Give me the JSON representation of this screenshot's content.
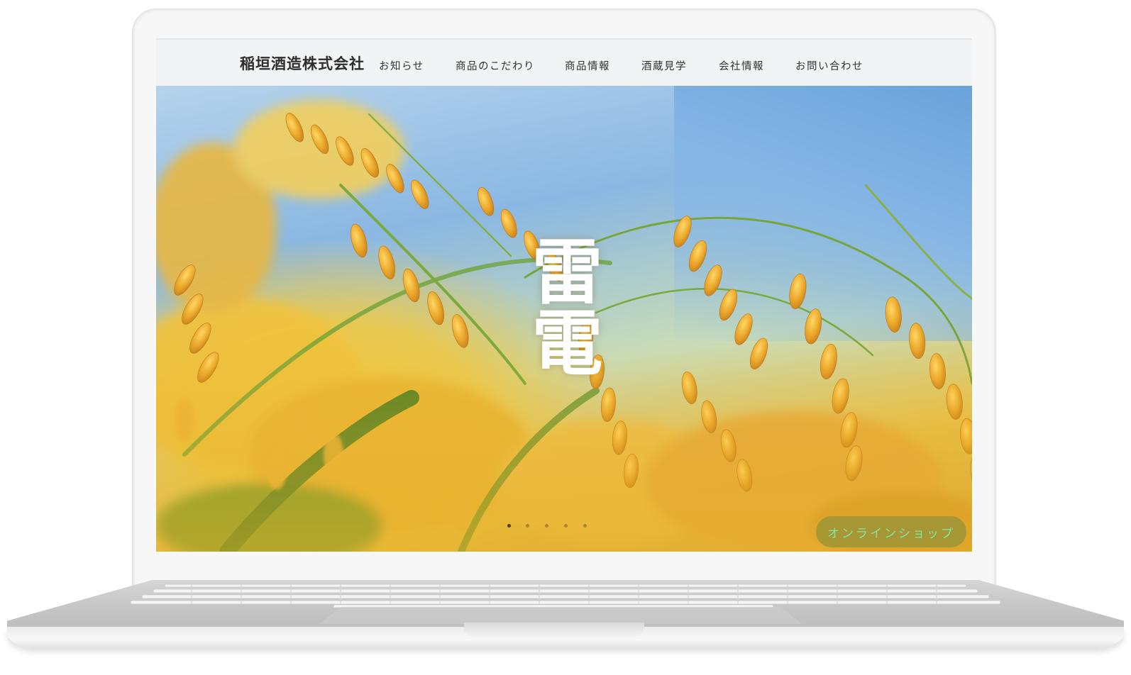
{
  "site": {
    "brand": "稲垣酒造株式会社",
    "nav": [
      {
        "label": "お知らせ"
      },
      {
        "label": "商品のこだわり"
      },
      {
        "label": "商品情報"
      },
      {
        "label": "酒蔵見学"
      },
      {
        "label": "会社情報"
      },
      {
        "label": "お問い合わせ"
      }
    ]
  },
  "hero": {
    "title": "雷電",
    "slides": {
      "count": 5,
      "active": 1
    },
    "shop_button": "オンラインショップ"
  },
  "colors": {
    "header_bg": "#f2f3f4",
    "shop_text": "#7fe6a4",
    "rice_gold": "#e8a92a"
  }
}
